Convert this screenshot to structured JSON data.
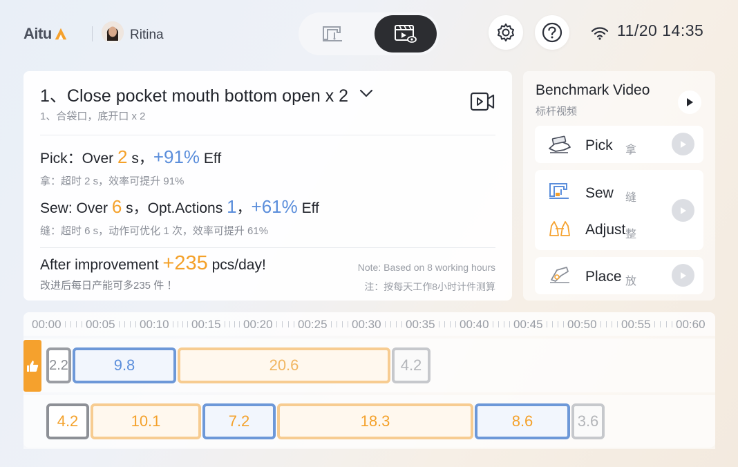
{
  "header": {
    "logo_text": "Aitu",
    "user_name": "Ritina",
    "datetime": "11/20 14:35"
  },
  "task": {
    "title": "1、Close pocket mouth bottom open x 2",
    "subtitle": "1、合袋口，底开口 x 2",
    "pick": {
      "prefix": "Pick：Over ",
      "over_value": "2",
      "mid": " s，",
      "eff_value": "+91%",
      "suffix": " Eff",
      "sub": "拿：超时 2 s，效率可提升 91%"
    },
    "sew": {
      "prefix": "Sew: Over ",
      "over_value": "6",
      "mid": " s，Opt.Actions ",
      "actions_value": "1",
      "mid2": "，",
      "eff_value": "+61%",
      "suffix": " Eff",
      "sub": "缝：超时 6 s，动作可优化 1 次，效率可提升 61%"
    },
    "after": {
      "prefix": "After improvement ",
      "value": "+235",
      "suffix": " pcs/day!",
      "sub": "改进后每日产能可多235 件 ！",
      "note_en": "Note: Based on 8 working hours",
      "note_cn": "注：按每天工作8小时计件测算"
    }
  },
  "benchmark": {
    "title": "Benchmark Video",
    "subtitle": "标杆视频",
    "steps": [
      {
        "label": "Pick",
        "cn": "拿",
        "icon": "hand-pick-icon"
      },
      {
        "label": "Sew",
        "cn": "缝",
        "icon": "sewing-machine-icon"
      },
      {
        "label": "Adjust",
        "cn": "整",
        "icon": "hands-adjust-icon"
      },
      {
        "label": "Place",
        "cn": "放",
        "icon": "hand-place-icon"
      }
    ]
  },
  "timeline": {
    "ticks": [
      "00:00",
      "00:05",
      "00:10",
      "00:15",
      "00:20",
      "00:25",
      "00:30",
      "00:35",
      "00:40",
      "00:45",
      "00:50",
      "00:55",
      "00:60"
    ],
    "benchmark_row": [
      "2.2",
      "9.8",
      "20.6",
      "4.2"
    ],
    "current_row": [
      "4.2",
      "10.1",
      "7.2",
      "18.3",
      "8.6",
      "3.6"
    ]
  },
  "colors": {
    "accent_orange": "#f4a12a",
    "accent_blue": "#5b8edb",
    "dark_toggle": "#2c2d31"
  }
}
